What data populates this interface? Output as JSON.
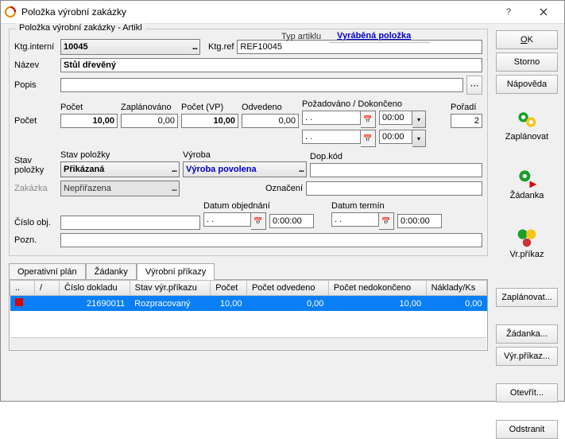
{
  "window": {
    "title": "Položka výrobní zakázky"
  },
  "side_buttons": {
    "ok": "OK",
    "storno": "Storno",
    "napoveda": "Nápověda",
    "zaplanovat": "Zaplánovat",
    "zadanka": "Žádanka",
    "vrprikaz": "Vr.příkaz",
    "zaplanovat2": "Zaplánovat...",
    "zadanka2": "Žádanka...",
    "vyrprikaz2": "Výr.příkaz...",
    "otevrit": "Otevřít...",
    "odstranit": "Odstranit"
  },
  "group1_title": "Položka výrobní zakázky - Artikl",
  "typ": {
    "label": "Typ artiklu",
    "value": "Vyráběná položka"
  },
  "labels": {
    "ktg_interni": "Ktg.interní",
    "ktg_ref": "Ktg.ref",
    "nazev": "Název",
    "popis": "Popis",
    "pocet_row": "Počet",
    "pocet": "Počet",
    "zaplanovano": "Zaplánováno",
    "pocet_vp": "Počet (VP)",
    "odvedeno": "Odvedeno",
    "pozadovano": "Požadováno / Dokončeno",
    "poradi": "Pořadí",
    "stav_polozky_row": "Stav položky",
    "stav_polozky": "Stav položky",
    "vyroba": "Výroba",
    "dop_kod": "Dop.kód",
    "zakazka": "Zakázka",
    "oznaceni": "Označení",
    "cislo_obj": "Číslo obj.",
    "datum_objednani": "Datum objednání",
    "datum_termin": "Datum termín",
    "pozn": "Pozn."
  },
  "fields": {
    "ktg_interni": "10045",
    "ktg_ref": "REF10045",
    "nazev": "Stůl dřevěný",
    "popis": "",
    "pocet": "10,00",
    "zaplanovano": "0,00",
    "pocet_vp": "10,00",
    "odvedeno": "0,00",
    "pozadovano_date": ". .",
    "pozadovano_time": "00:00",
    "dokonceno_date": ". .",
    "dokonceno_time": "00:00",
    "poradi": "2",
    "stav_polozky": "Přikázaná",
    "vyroba": "Výroba povolena",
    "dop_kod": "",
    "zakazka": "Nepřiřazena",
    "oznaceni": "",
    "cislo_obj": "",
    "datum_obj": ". .",
    "datum_obj_time": "0:00:00",
    "datum_termin": ". .",
    "datum_termin_time": "0:00:00",
    "pozn": ""
  },
  "tabs": {
    "t1": "Operativní plán",
    "t2": "Žádanky",
    "t3": "Výrobní příkazy"
  },
  "grid": {
    "headers": {
      "c0": "..",
      "c1": "/",
      "c2": "Číslo dokladu",
      "c3": "Stav výr.příkazu",
      "c4": "Počet",
      "c5": "Počet odvedeno",
      "c6": "Počet nedokončeno",
      "c7": "Náklady/Ks"
    },
    "row": {
      "cislo": "21690011",
      "stav": "Rozpracovaný",
      "pocet": "10,00",
      "odvedeno": "0,00",
      "nedokonceno": "10,00",
      "naklady": "0,00"
    }
  }
}
